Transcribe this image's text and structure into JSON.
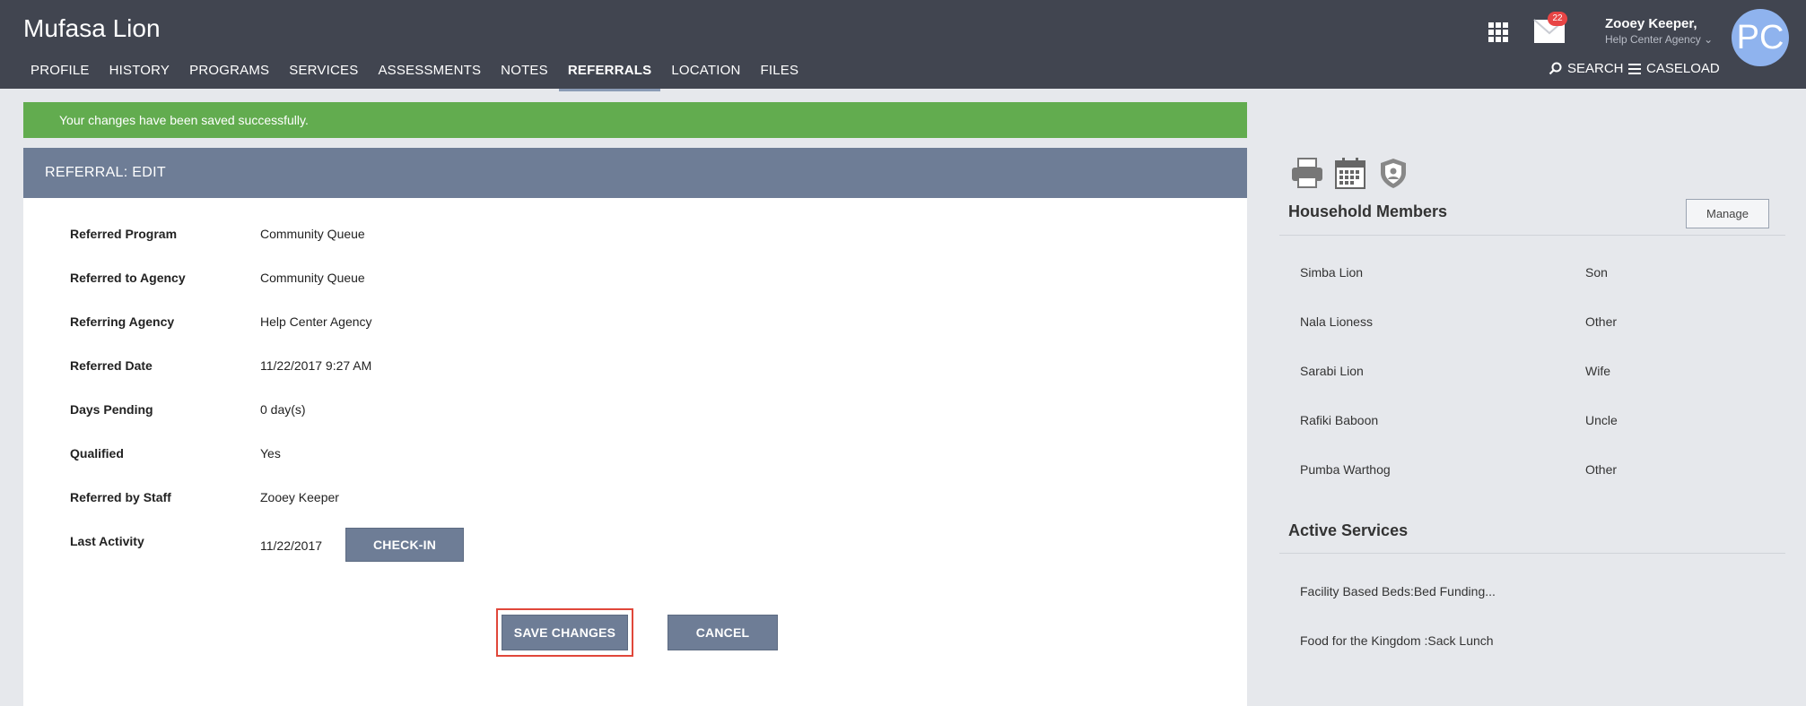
{
  "header": {
    "client_name": "Mufasa Lion",
    "nav": [
      "PROFILE",
      "HISTORY",
      "PROGRAMS",
      "SERVICES",
      "ASSESSMENTS",
      "NOTES",
      "REFERRALS",
      "LOCATION",
      "FILES"
    ],
    "active_tab": "REFERRALS",
    "search_label": "SEARCH",
    "caseload_label": "CASELOAD",
    "mail_count": "22",
    "user_name": "Zooey Keeper,",
    "user_agency": "Help Center Agency",
    "avatar_initials": "PC"
  },
  "banner": {
    "message": "Your changes have been saved successfully."
  },
  "referral": {
    "title": "REFERRAL: EDIT",
    "fields": [
      {
        "label": "Referred Program",
        "value": "Community Queue"
      },
      {
        "label": "Referred to Agency",
        "value": "Community Queue"
      },
      {
        "label": "Referring Agency",
        "value": "Help Center Agency"
      },
      {
        "label": "Referred Date",
        "value": "11/22/2017 9:27 AM"
      },
      {
        "label": "Days Pending",
        "value": "0 day(s)"
      },
      {
        "label": "Qualified",
        "value": "Yes"
      },
      {
        "label": "Referred by Staff",
        "value": "Zooey Keeper"
      },
      {
        "label": "Last Activity",
        "value": "11/22/2017"
      }
    ],
    "checkin_label": "CHECK-IN",
    "save_label": "SAVE CHANGES",
    "cancel_label": "CANCEL"
  },
  "sidebar": {
    "household_title": "Household Members",
    "manage_label": "Manage",
    "members": [
      {
        "name": "Simba Lion",
        "relation": "Son"
      },
      {
        "name": "Nala Lioness",
        "relation": "Other"
      },
      {
        "name": "Sarabi Lion",
        "relation": "Wife"
      },
      {
        "name": "Rafiki Baboon",
        "relation": "Uncle"
      },
      {
        "name": "Pumba Warthog",
        "relation": "Other"
      }
    ],
    "services_title": "Active Services",
    "services": [
      "Facility Based Beds:Bed Funding...",
      "Food for the Kingdom :Sack Lunch"
    ]
  },
  "colors": {
    "header_bg": "#414550",
    "panel_header": "#6e7d96",
    "success": "#62ac4f",
    "highlight": "#e0473a",
    "avatar": "#8fb3ee"
  }
}
